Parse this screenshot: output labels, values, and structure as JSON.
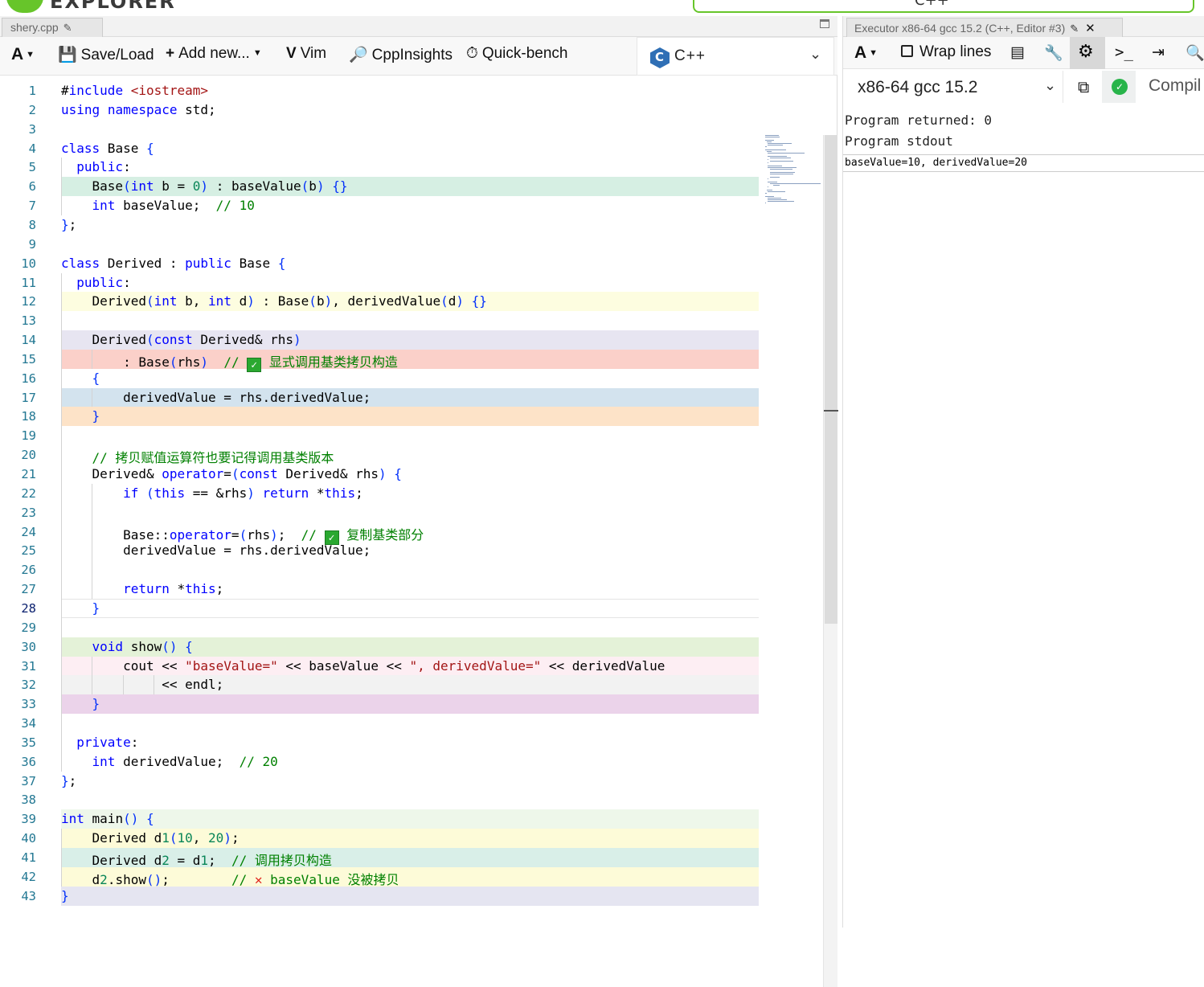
{
  "header": {
    "logo_text": "EXPLORER",
    "language_badge": "C++"
  },
  "editor": {
    "tab_title": "shery.cpp",
    "toolbar": {
      "font_label": "A",
      "save_load": "Save/Load",
      "add_new": "Add new...",
      "vim": "Vim",
      "cppinsights": "CppInsights",
      "quickbench": "Quick-bench"
    },
    "language": "C++",
    "current_line": 28,
    "lines": [
      "#include <iostream>",
      "using namespace std;",
      "",
      "class Base {",
      "  public:",
      "    Base(int b = 0) : baseValue(b) {}",
      "    int baseValue;  // 10",
      "};",
      "",
      "class Derived : public Base {",
      "  public:",
      "    Derived(int b, int d) : Base(b), derivedValue(d) {}",
      "",
      "    Derived(const Derived& rhs)",
      "        : Base(rhs)  // ✅ 显式调用基类拷贝构造",
      "    {",
      "        derivedValue = rhs.derivedValue;",
      "    }",
      "",
      "    // 拷贝赋值运算符也要记得调用基类版本",
      "    Derived& operator=(const Derived& rhs) {",
      "        if (this == &rhs) return *this;",
      "",
      "        Base::operator=(rhs);  // ✅ 复制基类部分",
      "        derivedValue = rhs.derivedValue;",
      "",
      "        return *this;",
      "    }",
      "",
      "    void show() {",
      "        cout << \"baseValue=\" << baseValue << \", derivedValue=\" << derivedValue",
      "             << endl;",
      "    }",
      "",
      "  private:",
      "    int derivedValue;  // 20",
      "};",
      "",
      "int main() {",
      "    Derived d1(10, 20);",
      "    Derived d2 = d1;  // 调用拷贝构造",
      "    d2.show();        // ❌ baseValue 没被拷贝",
      "}"
    ]
  },
  "executor": {
    "tab_title": "Executor x86-64 gcc 15.2 (C++, Editor #3)",
    "toolbar": {
      "font_label": "A",
      "wrap_lines": "Wrap lines"
    },
    "compiler": "x86-64 gcc 15.2",
    "compile_label": "Compil",
    "program_returned": "Program returned: 0",
    "program_stdout": "Program stdout",
    "stdout": "baseValue=10, derivedValue=20"
  },
  "colors": {
    "keyword": "#0000ff",
    "string": "#a31515",
    "comment": "#008000",
    "number": "#098658",
    "line_number": "#237893",
    "brand_green": "#67c52a"
  }
}
